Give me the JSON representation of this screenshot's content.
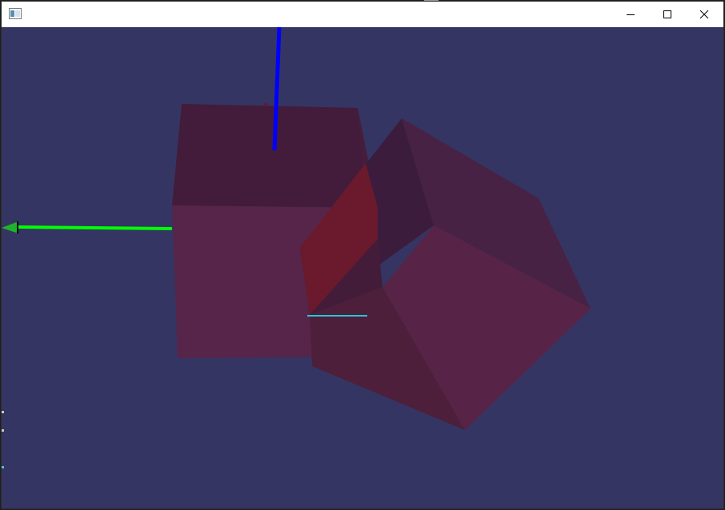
{
  "window": {
    "title": "",
    "icon": "app-window-icon",
    "controls": {
      "minimize_icon": "minimize-icon",
      "maximize_icon": "maximize-icon",
      "close_icon": "close-icon"
    }
  },
  "scene": {
    "background_color": "#353563",
    "axes": [
      {
        "id": "z-axis",
        "color": "#0000ff"
      },
      {
        "id": "y-axis",
        "color": "#00ff00"
      },
      {
        "id": "x-axis",
        "color": "#00c8d0"
      }
    ],
    "objects": [
      {
        "id": "cube-1",
        "color": "#8b1a2a",
        "opacity": "translucent"
      },
      {
        "id": "cube-2",
        "color": "#8b1a2a",
        "opacity": "translucent"
      }
    ]
  }
}
